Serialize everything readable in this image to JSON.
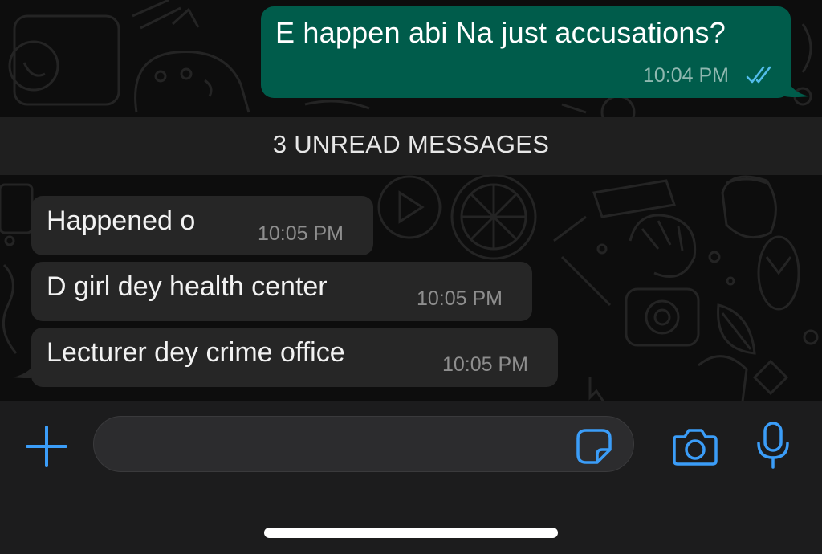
{
  "outgoing": {
    "text": "E happen abi Na just accusations?",
    "time": "10:04 PM",
    "status_icon": "double-check-read-icon"
  },
  "unread_banner": "3 UNREAD MESSAGES",
  "incoming": [
    {
      "text": "Happened o",
      "time": "10:05 PM"
    },
    {
      "text": "D girl dey health center",
      "time": "10:05 PM"
    },
    {
      "text": "Lecturer dey crime office",
      "time": "10:05 PM"
    }
  ],
  "input": {
    "value": "",
    "placeholder": ""
  },
  "icons": {
    "attach": "plus-icon",
    "sticker": "sticker-icon",
    "camera": "camera-icon",
    "mic": "microphone-icon"
  },
  "colors": {
    "accent": "#3b9df8",
    "outgoing_bubble": "#005c4b",
    "incoming_bubble": "#262626",
    "read_ticks": "#53bdeb"
  }
}
